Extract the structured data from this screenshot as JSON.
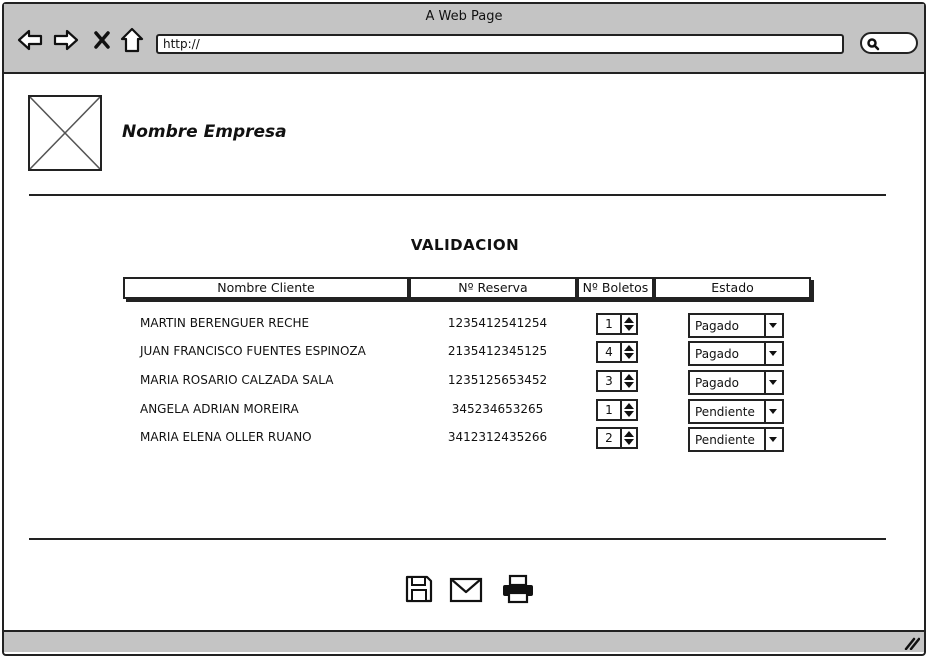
{
  "browser": {
    "title": "A Web Page",
    "url": "http://"
  },
  "header": {
    "company_name": "Nombre Empresa"
  },
  "main": {
    "section_title": "VALIDACION",
    "columns": [
      "Nombre Cliente",
      "Nº Reserva",
      "Nº Boletos",
      "Estado"
    ],
    "rows": [
      {
        "nombre": "MARTIN BERENGUER RECHE",
        "reserva": "1235412541254",
        "boletos": "1",
        "estado": "Pagado"
      },
      {
        "nombre": "JUAN FRANCISCO FUENTES ESPINOZA",
        "reserva": "2135412345125",
        "boletos": "4",
        "estado": "Pagado"
      },
      {
        "nombre": "MARIA ROSARIO CALZADA SALA",
        "reserva": "1235125653452",
        "boletos": "3",
        "estado": "Pagado"
      },
      {
        "nombre": "ANGELA ADRIAN MOREIRA",
        "reserva": "345234653265",
        "boletos": "1",
        "estado": "Pendiente"
      },
      {
        "nombre": "MARIA ELENA OLLER RUANO",
        "reserva": "3412312435266",
        "boletos": "2",
        "estado": "Pendiente"
      }
    ]
  },
  "footer": {
    "icons": [
      "save-icon",
      "mail-icon",
      "print-icon"
    ]
  }
}
